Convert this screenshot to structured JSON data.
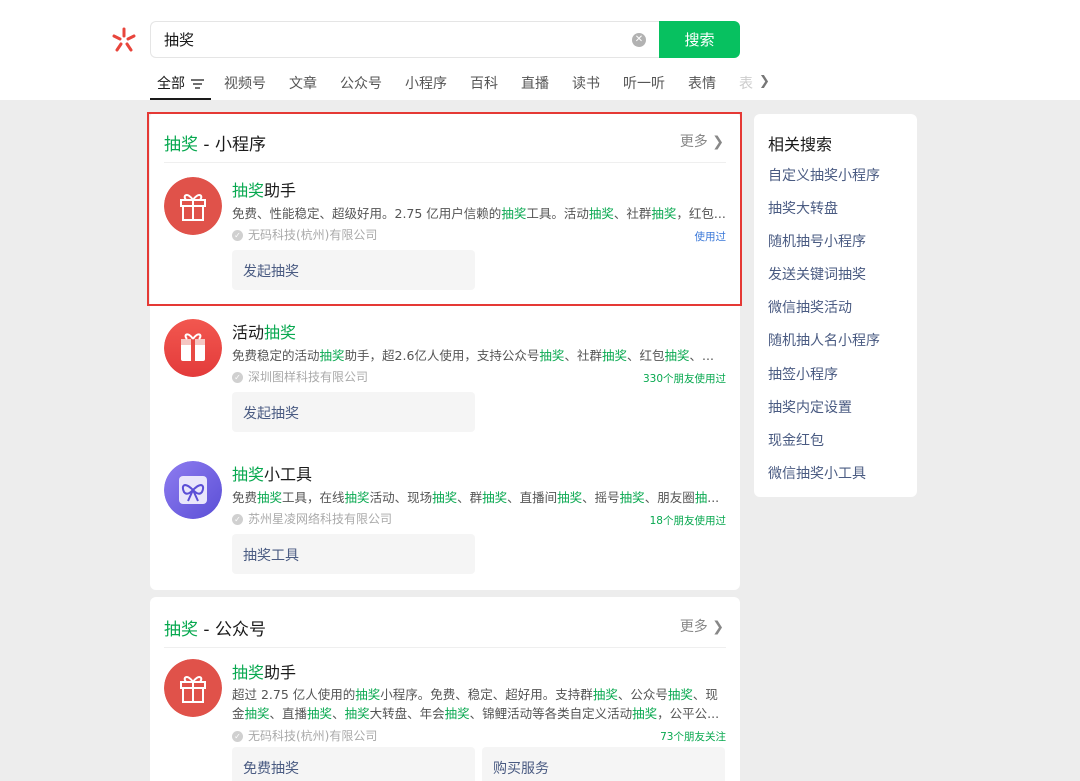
{
  "search": {
    "query": "抽奖",
    "button_label": "搜索"
  },
  "tabs": [
    "全部",
    "视频号",
    "文章",
    "公众号",
    "小程序",
    "百科",
    "直播",
    "读书",
    "听一听",
    "表情",
    "表"
  ],
  "colors": {
    "accent_green": "#07c160",
    "highlight_green": "#07a84f",
    "link_blue": "#4a5b82",
    "red_box": "#e53935"
  },
  "miniprogram_section": {
    "title_highlight": "抽奖",
    "title_rest": " - 小程序",
    "more_label": "更多",
    "items": [
      {
        "title_highlight": "抽奖",
        "title_rest": "助手",
        "desc_parts": [
          "免费、性能稳定、超级好用。2.75 亿用户信赖的",
          "抽奖",
          "工具。活动",
          "抽奖",
          "、社群",
          "抽奖",
          "，红包..."
        ],
        "org": "无码科技(杭州)有限公司",
        "stat": "使用过",
        "action": "发起抽奖",
        "icon": "gift-icon"
      },
      {
        "title_highlight": "抽奖",
        "title_prefix": "活动",
        "desc_parts": [
          "免费稳定的活动",
          "抽奖",
          "助手，超2.6亿人使用，支持公众号",
          "抽奖",
          "、社群",
          "抽奖",
          "、红包",
          "抽奖",
          "、..."
        ],
        "org": "深圳图样科技有限公司",
        "stat": "330个朋友使用过",
        "action": "发起抽奖",
        "icon": "gift-box-icon"
      },
      {
        "title_highlight": "抽奖",
        "title_rest": "小工具",
        "desc_parts": [
          "免费",
          "抽奖",
          "工具，在线",
          "抽奖",
          "活动、现场",
          "抽奖",
          "、群",
          "抽奖",
          "、直播间",
          "抽奖",
          "、摇号",
          "抽奖",
          "、朋友圈",
          "抽",
          "..."
        ],
        "org": "苏州星凌网络科技有限公司",
        "stat": "18个朋友使用过",
        "action": "抽奖工具",
        "icon": "ribbon-gift-icon"
      }
    ]
  },
  "official_section": {
    "title_highlight": "抽奖",
    "title_rest": " - 公众号",
    "more_label": "更多",
    "item": {
      "title_highlight": "抽奖",
      "title_rest": "助手",
      "desc_parts": [
        "超过 2.75 亿人使用的",
        "抽奖",
        "小程序。免费、稳定、超好用。支持群",
        "抽奖",
        "、公众号",
        "抽奖",
        "、现金",
        "抽奖",
        "、直播",
        "抽奖",
        "、",
        "抽奖",
        "大转盘、年会",
        "抽奖",
        "、锦鲤活动等各类自定义活动",
        "抽奖",
        "，公平公..."
      ],
      "org": "无码科技(杭州)有限公司",
      "stat": "73个朋友关注",
      "actions": [
        "免费抽奖",
        "购买服务"
      ],
      "icon": "gift-icon"
    }
  },
  "related": {
    "title": "相关搜索",
    "items": [
      "自定义抽奖小程序",
      "抽奖大转盘",
      "随机抽号小程序",
      "发送关键词抽奖",
      "微信抽奖活动",
      "随机抽人名小程序",
      "抽签小程序",
      "抽奖内定设置",
      "现金红包",
      "微信抽奖小工具"
    ]
  }
}
